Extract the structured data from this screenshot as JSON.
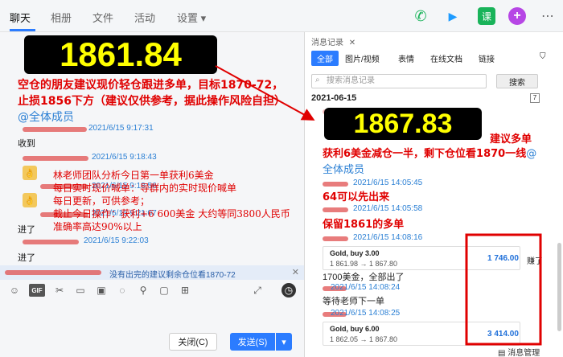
{
  "tabs": [
    "聊天",
    "相册",
    "文件",
    "活动",
    "设置 ▾"
  ],
  "top_icons": [
    {
      "name": "phone-icon",
      "glyph": "✆",
      "color": "#19b35a"
    },
    {
      "name": "video-icon",
      "glyph": "▶",
      "color": "#1e9bff"
    },
    {
      "name": "class-icon",
      "glyph": "课",
      "color": "#19b35a"
    },
    {
      "name": "plus-icon",
      "glyph": "+",
      "color": "#b646e5"
    }
  ],
  "chat": {
    "price1": "1861.84",
    "advice": "空仓的朋友建议现价轻仓跟进多单，目标1870-72，止损1856下方（建议仅供参考，据此操作风险自担）",
    "mention": "@全体成员",
    "ts1": "2021/6/15 9:17:31",
    "msg_received": "收到",
    "ts2": "2021/6/15 9:18:43",
    "overlay_lines": [
      "林老师团队分析今日第一单获利6美金",
      "每日实时现价喊单：导群内的实时现价喊单",
      "每日更新，可供参考；",
      "截止今日操作：获利+6  600美金   大约等同3800人民币",
      "准确率高达90%以上"
    ],
    "ts3": "2021/6/15 9:18:56",
    "ts4": "2021/6/15 9:21:07",
    "msg_jin1": "进了",
    "ts5": "2021/6/15 9:22:03",
    "msg_jin2": "进了",
    "quote_text": "没有出完的建议剩余仓位看1870-72",
    "close_label": "关闭(C)",
    "send_label": "发送(S)"
  },
  "history": {
    "title": "消息记录",
    "tabs": [
      "全部",
      "图片/视频",
      "表情",
      "在线文档",
      "链接"
    ],
    "search_placeholder": "搜索消息记录",
    "search_button": "搜索",
    "date": "2021-06-15",
    "price2": "1867.83",
    "line1": "建议多单",
    "line2": "获利6美金减仓一半，剩下仓位看1870一线",
    "mention": "@全体成员",
    "ts_a": "2021/6/15 14:05:45",
    "line3": "64可以先出来",
    "ts_b": "2021/6/15 14:05:58",
    "line4": "保留1861的多单",
    "ts_c": "2021/6/15 14:08:16",
    "card1": {
      "label": "Gold, buy 3.00",
      "range": "1 861.98 → 1 867.80",
      "profit": "1 746.00",
      "side": "赚了"
    },
    "msg_1700": "1700美金，全部出了",
    "ts_d": "2021/6/15 14:08:24",
    "msg_wait": "等待老师下一单",
    "ts_e": "2021/6/15 14:08:25",
    "card2": {
      "label": "Gold, buy 6.00",
      "range": "1 862.05 → 1 867.80",
      "profit": "3 414.00"
    },
    "manage": "消息管理"
  }
}
